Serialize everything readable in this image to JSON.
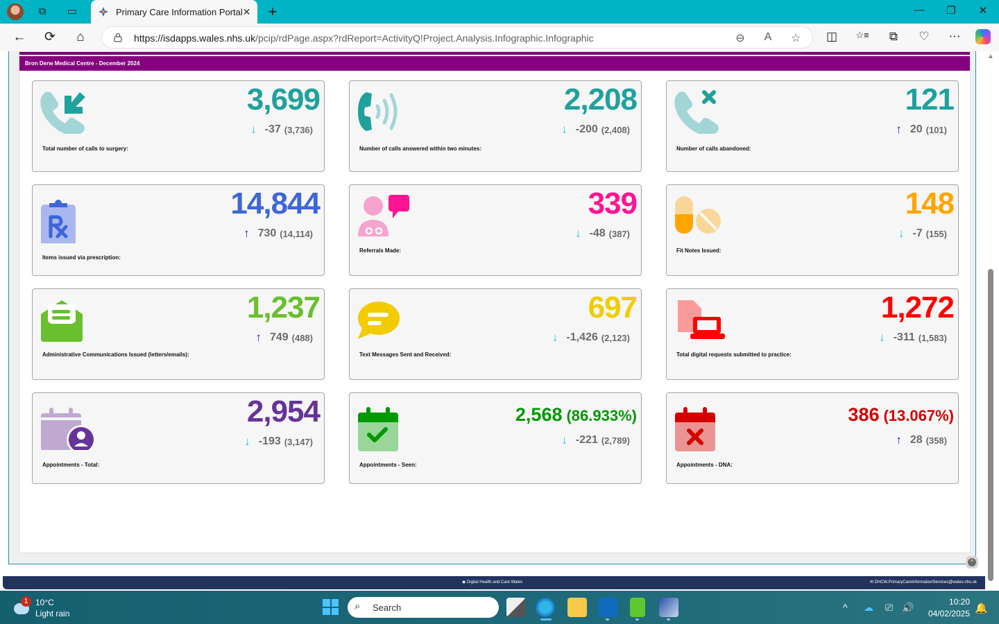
{
  "browser": {
    "tab_title": "Primary Care Information Portal",
    "url_host": "https://isdapps.wales.nhs.uk",
    "url_path": "/pcip/rdPage.aspx?rdReport=ActivityQ!Project.Analysis.Infographic.Infographic",
    "icons": {
      "back": "←",
      "refresh": "⟳",
      "home": "⌂",
      "zoom_out": "⊖",
      "read_aloud": "A",
      "favorite": "☆",
      "split": "◫",
      "favorites": "☆≡",
      "collections": "⧉",
      "health": "♡",
      "more": "⋯",
      "minimize": "—",
      "restore": "❐",
      "close": "✕",
      "tab_close": "✕",
      "new_tab": "+",
      "workspaces": "⧉",
      "tab_actions": "▭"
    }
  },
  "report": {
    "header": "Bron Derw Medical Centre - December 2024",
    "colors": {
      "header_band": "#84007e",
      "down_arrow": "#1ec3ea",
      "up_arrow": "#1a12e6",
      "change_text": "#6b6b6b"
    },
    "cards": [
      {
        "label": "Total number of calls to surgery:",
        "value": "3,699",
        "direction": "down",
        "arrow": "↓",
        "change": "-37",
        "previous": "(3,736)",
        "color": "#1fa19c",
        "icon": "phone-incoming-icon"
      },
      {
        "label": "Number of calls answered within two minutes:",
        "value": "2,208",
        "direction": "down",
        "arrow": "↓",
        "change": "-200",
        "previous": "(2,408)",
        "color": "#1fa19c",
        "icon": "phone-ringing-icon"
      },
      {
        "label": "Number of calls abandoned:",
        "value": "121",
        "direction": "up",
        "arrow": "↑",
        "change": "20",
        "previous": "(101)",
        "color": "#1fa19c",
        "icon": "phone-missed-icon"
      },
      {
        "label": "Items issued via prescription:",
        "value": "14,844",
        "direction": "up",
        "arrow": "↑",
        "change": "730",
        "previous": "(14,114)",
        "color": "#3f66d6",
        "icon": "prescription-clipboard-icon"
      },
      {
        "label": "Referrals Made:",
        "value": "339",
        "direction": "down",
        "arrow": "↓",
        "change": "-48",
        "previous": "(387)",
        "color": "#ff1493",
        "icon": "doctor-chat-icon"
      },
      {
        "label": "Fit Notes Issued:",
        "value": "148",
        "direction": "down",
        "arrow": "↓",
        "change": "-7",
        "previous": "(155)",
        "color": "#ffa500",
        "icon": "pills-icon"
      },
      {
        "label": "Administrative Communications Issued (letters/emails):",
        "value": "1,237",
        "direction": "up",
        "arrow": "↑",
        "change": "749",
        "previous": "(488)",
        "color": "#6abf2e",
        "icon": "open-envelope-icon"
      },
      {
        "label": "Text Messages Sent and Received:",
        "value": "697",
        "direction": "down",
        "arrow": "↓",
        "change": "-1,426",
        "previous": "(2,123)",
        "color": "#f2cb00",
        "icon": "speech-bubble-icon"
      },
      {
        "label": "Total digital requests submitted to practice:",
        "value": "1,272",
        "direction": "down",
        "arrow": "↓",
        "change": "-311",
        "previous": "(1,583)",
        "color": "#ff0000",
        "icon": "document-laptop-icon"
      },
      {
        "label": "Appointments - Total:",
        "value": "2,954",
        "direction": "down",
        "arrow": "↓",
        "change": "-193",
        "previous": "(3,147)",
        "color": "#663399",
        "icon": "calendar-user-icon"
      },
      {
        "label": "Appointments - Seen:",
        "value": "2,568",
        "percent": "(86.933%)",
        "direction": "down",
        "arrow": "↓",
        "change": "-221",
        "previous": "(2,789)",
        "color": "#009900",
        "icon": "calendar-check-icon"
      },
      {
        "label": "Appointments - DNA:",
        "value": "386",
        "percent": "(13.067%)",
        "direction": "up",
        "arrow": "↑",
        "change": "28",
        "previous": "(358)",
        "color": "#d40000",
        "icon": "calendar-x-icon"
      }
    ],
    "footer": {
      "center": "Digital Health and Care Wales",
      "email": "DHCW.PrimaryCareInformationServices@wales.nhs.uk",
      "scroll_top_icon": "^"
    }
  },
  "taskbar": {
    "weather_temp": "10°C",
    "weather_condition": "Light rain",
    "weather_badge": "1",
    "search_placeholder": "Search",
    "search_icon": "⌕",
    "time": "10:20",
    "date": "04/02/2025",
    "tray": {
      "chevron": "^",
      "volume": "🔊",
      "network": "⎚",
      "bell": "🔔"
    }
  }
}
